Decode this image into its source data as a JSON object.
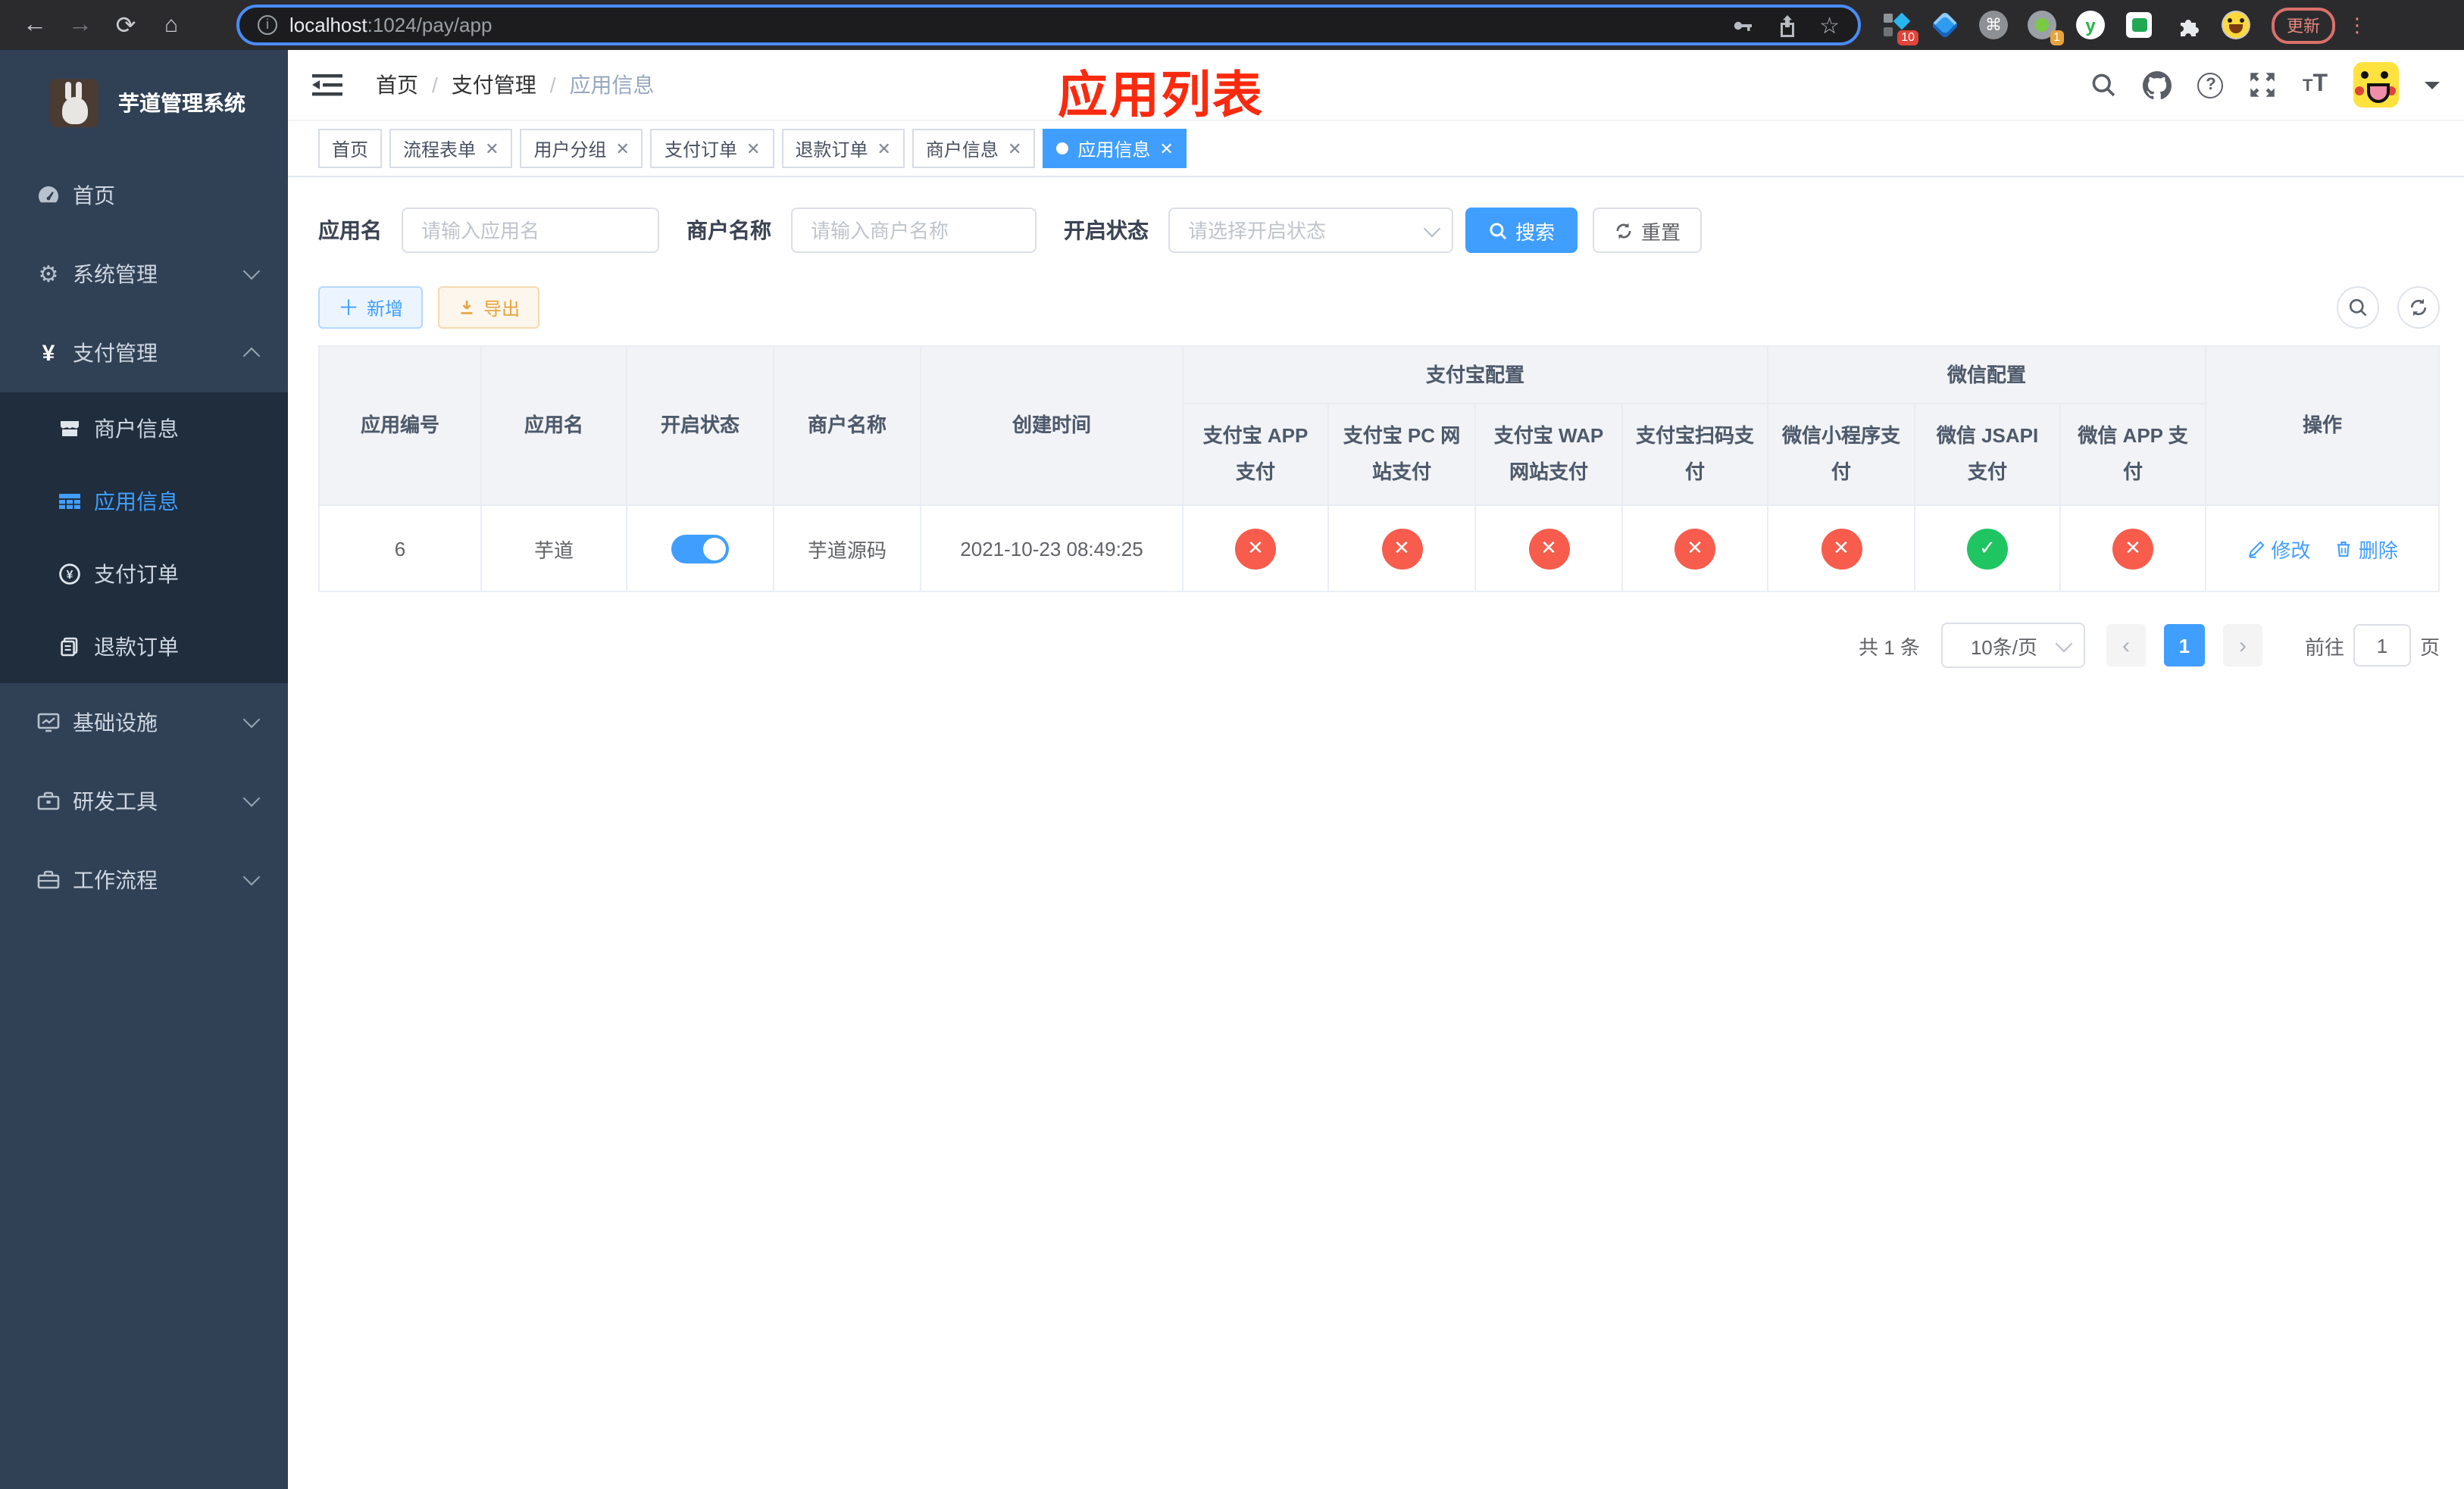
{
  "browser": {
    "url_host": "localhost",
    "url_rest": ":1024/pay/app",
    "update_button": "更新",
    "menu_dots": "⋮",
    "ext_badge_tampermonkey": "10",
    "ext_badge_proxy": "1"
  },
  "sidebar": {
    "title": "芋道管理系统",
    "items": [
      {
        "label": "首页",
        "icon": "dashboard-icon",
        "expandable": false
      },
      {
        "label": "系统管理",
        "icon": "gear-icon",
        "expandable": true,
        "state": "collapsed"
      },
      {
        "label": "支付管理",
        "icon": "yen-icon",
        "expandable": true,
        "state": "expanded"
      },
      {
        "label": "基础设施",
        "icon": "monitor-icon",
        "expandable": true,
        "state": "collapsed"
      },
      {
        "label": "研发工具",
        "icon": "toolbox-icon",
        "expandable": true,
        "state": "collapsed"
      },
      {
        "label": "工作流程",
        "icon": "briefcase-icon",
        "expandable": true,
        "state": "collapsed"
      }
    ],
    "submenu": [
      {
        "label": "商户信息",
        "icon": "shop-icon",
        "active": false
      },
      {
        "label": "应用信息",
        "icon": "grid-icon",
        "active": true
      },
      {
        "label": "支付订单",
        "icon": "pay-order-icon",
        "active": false
      },
      {
        "label": "退款订单",
        "icon": "refund-order-icon",
        "active": false
      }
    ]
  },
  "navbar": {
    "breadcrumb": [
      "首页",
      "支付管理",
      "应用信息"
    ],
    "annotation": "应用列表"
  },
  "tags": [
    {
      "label": "首页",
      "closable": false,
      "active": false
    },
    {
      "label": "流程表单",
      "closable": true,
      "active": false
    },
    {
      "label": "用户分组",
      "closable": true,
      "active": false
    },
    {
      "label": "支付订单",
      "closable": true,
      "active": false
    },
    {
      "label": "退款订单",
      "closable": true,
      "active": false
    },
    {
      "label": "商户信息",
      "closable": true,
      "active": false
    },
    {
      "label": "应用信息",
      "closable": true,
      "active": true
    }
  ],
  "filters": {
    "app_name_label": "应用名",
    "app_name_placeholder": "请输入应用名",
    "merchant_label": "商户名称",
    "merchant_placeholder": "请输入商户名称",
    "status_label": "开启状态",
    "status_placeholder": "请选择开启状态",
    "search_button": "搜索",
    "reset_button": "重置"
  },
  "toolbar": {
    "add_button": "新增",
    "export_button": "导出"
  },
  "table": {
    "columns": [
      "应用编号",
      "应用名",
      "开启状态",
      "商户名称",
      "创建时间"
    ],
    "group_alipay": "支付宝配置",
    "group_wechat": "微信配置",
    "alipay_columns": [
      "支付宝 APP 支付",
      "支付宝 PC 网站支付",
      "支付宝 WAP 网站支付",
      "支付宝扫码支付"
    ],
    "wechat_columns": [
      "微信小程序支付",
      "微信 JSAPI 支付",
      "微信 APP 支付"
    ],
    "ops_column": "操作",
    "row": {
      "id": "6",
      "name": "芋道",
      "status_on": true,
      "merchant": "芋道源码",
      "created": "2021-10-23 08:49:25",
      "pay_channels": [
        false,
        false,
        false,
        false,
        false,
        true,
        false
      ],
      "op_edit": "修改",
      "op_delete": "删除"
    }
  },
  "pagination": {
    "total": "共 1 条",
    "page_size": "10条/页",
    "page": "1",
    "goto_label": "前往",
    "goto_value": "1",
    "page_suffix": "页"
  },
  "colors": {
    "accent": "#409eff",
    "danger": "#f75c4d",
    "success": "#1ec561",
    "warning": "#e6a23c",
    "sidebar": "#304156"
  }
}
